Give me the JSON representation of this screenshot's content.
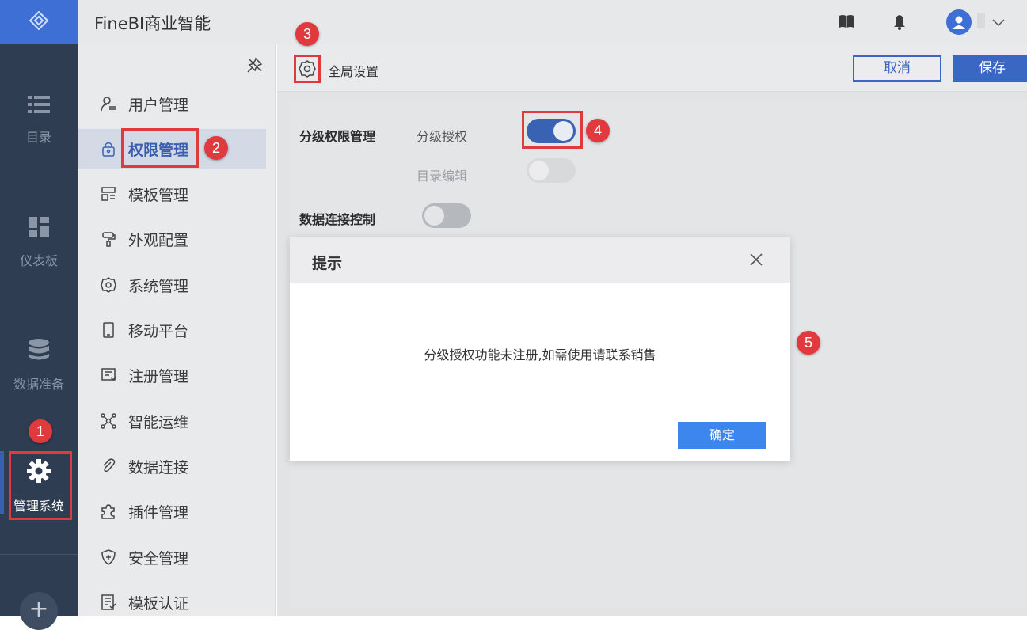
{
  "header": {
    "title": "FineBI商业智能",
    "icons": [
      "book-icon",
      "bell-icon",
      "user-avatar-icon",
      "chevron-down-icon"
    ]
  },
  "rail": {
    "items": [
      {
        "label": "目录",
        "icon": "list-icon"
      },
      {
        "label": "仪表板",
        "icon": "dashboard-grid-icon"
      },
      {
        "label": "数据准备",
        "icon": "database-icon"
      },
      {
        "label": "管理系统",
        "icon": "gear-icon",
        "active": true
      }
    ],
    "add_label": "+"
  },
  "submenu": {
    "items": [
      {
        "label": "用户管理",
        "icon": "user-list-icon"
      },
      {
        "label": "权限管理",
        "icon": "lock-icon",
        "active": true
      },
      {
        "label": "模板管理",
        "icon": "template-icon"
      },
      {
        "label": "外观配置",
        "icon": "paint-roller-icon"
      },
      {
        "label": "系统管理",
        "icon": "settings-icon"
      },
      {
        "label": "移动平台",
        "icon": "mobile-icon"
      },
      {
        "label": "注册管理",
        "icon": "register-icon"
      },
      {
        "label": "智能运维",
        "icon": "network-icon"
      },
      {
        "label": "数据连接",
        "icon": "link-icon"
      },
      {
        "label": "插件管理",
        "icon": "puzzle-icon"
      },
      {
        "label": "安全管理",
        "icon": "shield-icon"
      },
      {
        "label": "模板认证",
        "icon": "certificate-icon"
      }
    ]
  },
  "toolbar": {
    "title": "全局设置",
    "cancel_label": "取消",
    "save_label": "保存"
  },
  "settings": {
    "hierarchy_label": "分级权限管理",
    "hierarchy_grant_label": "分级授权",
    "hierarchy_grant_on": true,
    "catalog_edit_label": "目录编辑",
    "catalog_edit_on": false,
    "data_conn_label": "数据连接控制",
    "data_conn_on": false
  },
  "modal": {
    "title": "提示",
    "message": "分级授权功能未注册,如需使用请联系销售",
    "ok_label": "确定"
  },
  "annotations": [
    "1",
    "2",
    "3",
    "4",
    "5"
  ],
  "colors": {
    "accent": "#3a66c4",
    "callout": "#e0393e",
    "rail_bg": "#2f3d52",
    "ok_button": "#3d86ee"
  }
}
